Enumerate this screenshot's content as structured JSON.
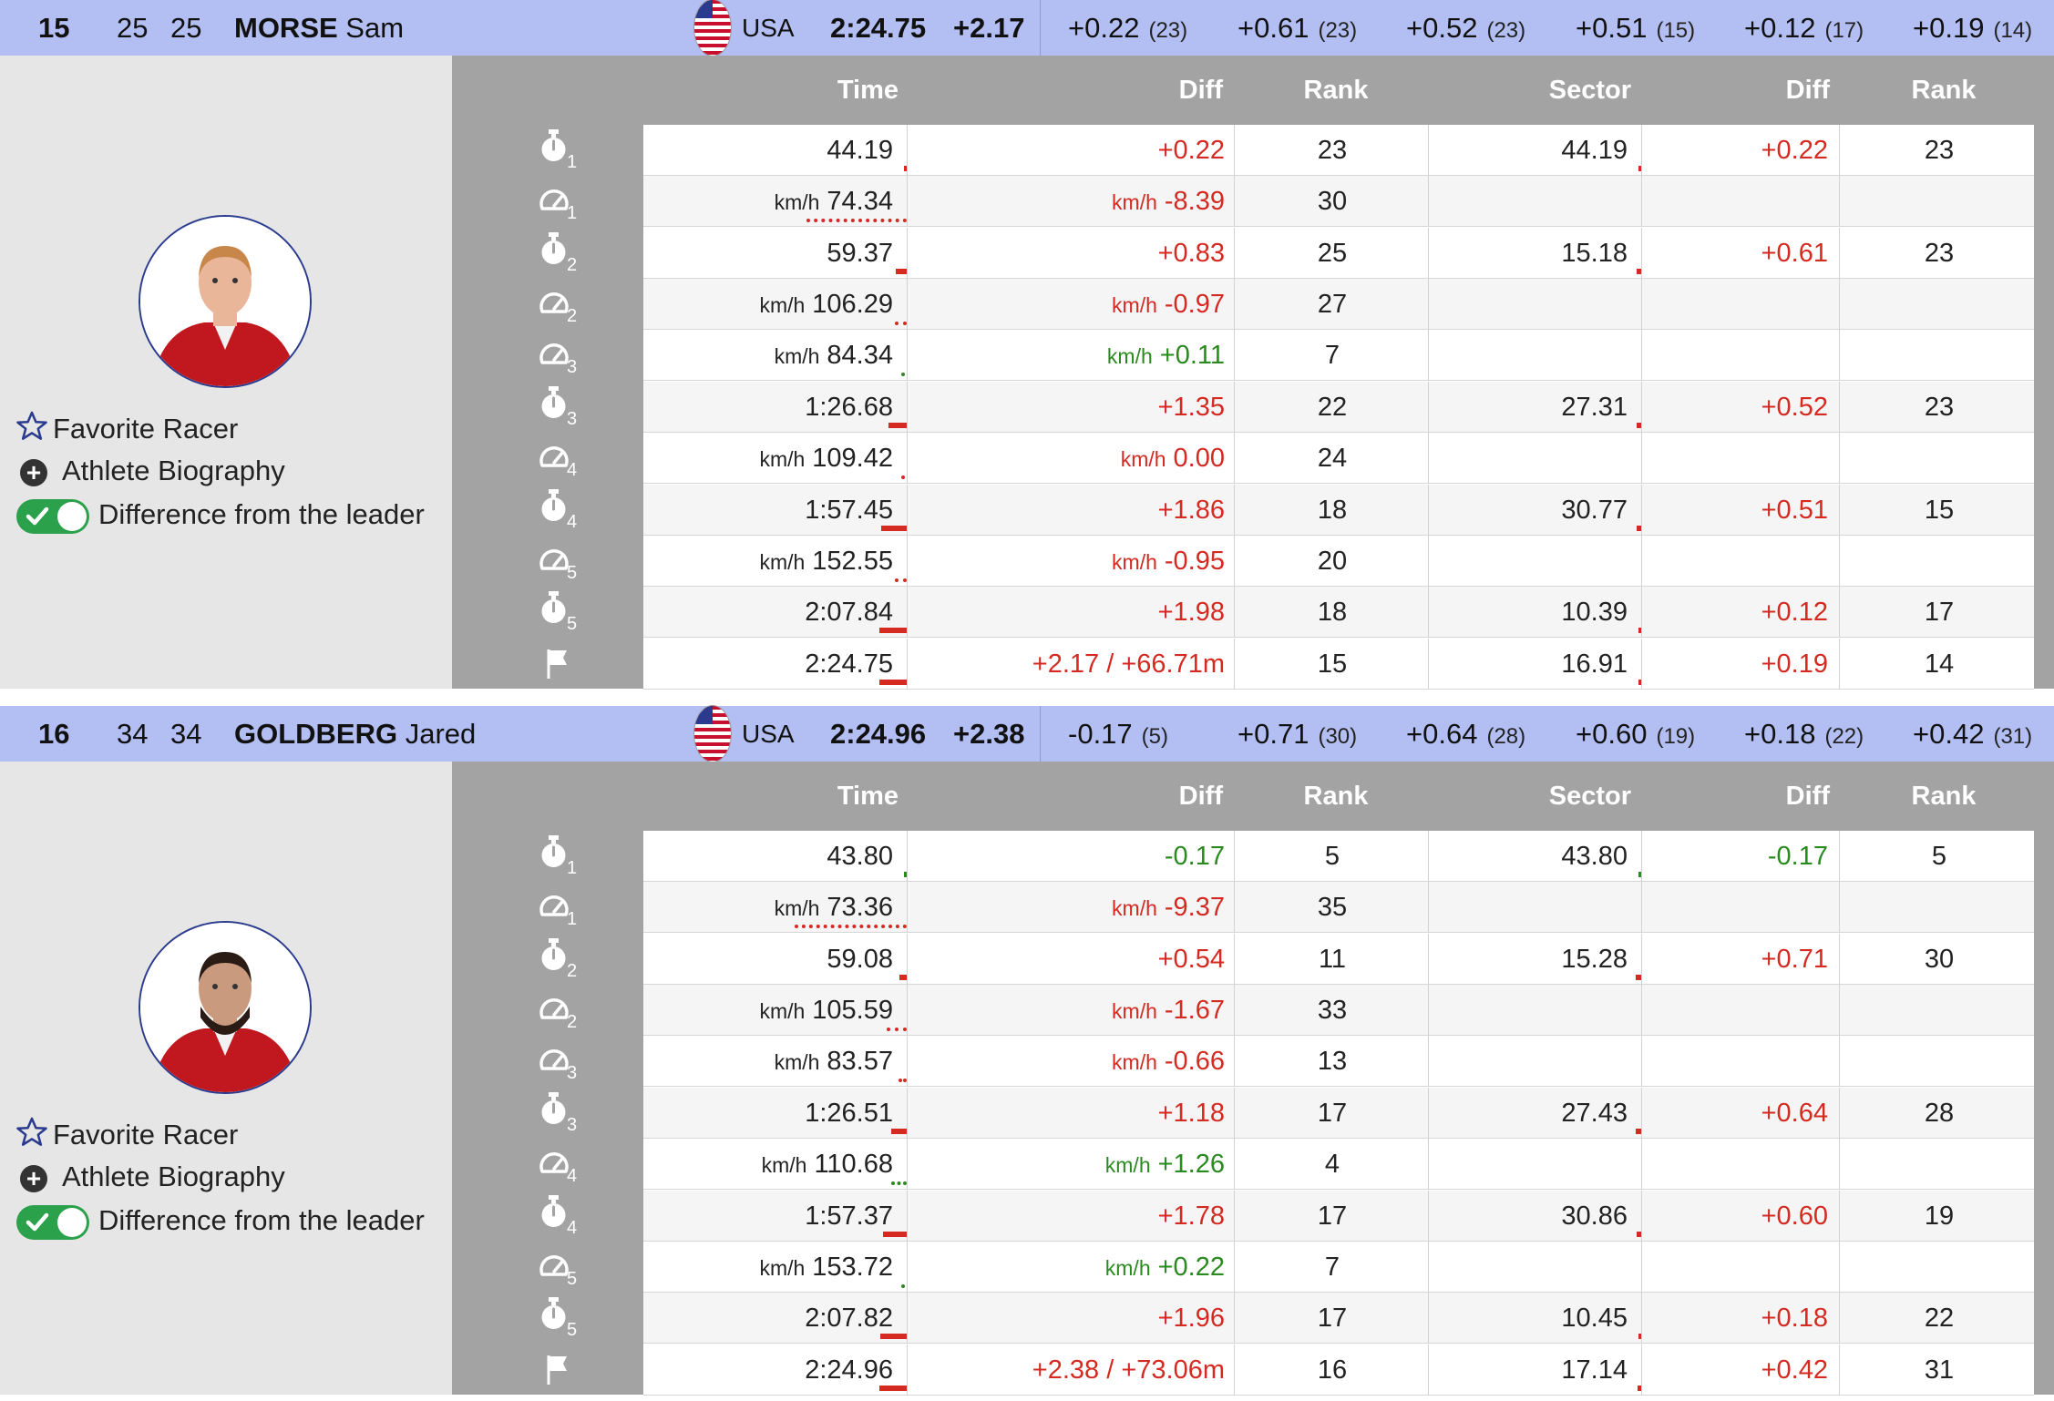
{
  "column_headers": {
    "time": "Time",
    "diff": "Diff",
    "rank": "Rank",
    "sector": "Sector",
    "sector_diff": "Diff",
    "sector_rank": "Rank"
  },
  "links": {
    "favorite": "Favorite Racer",
    "bio": "Athlete Biography",
    "toggle": "Difference from the leader"
  },
  "colors": {
    "header_bg": "#b3bef2",
    "left_bg": "#e6e6e6",
    "table_frame": "#a3a3a3",
    "negative": "#d42a22",
    "positive": "#2a8a1f",
    "toggle_on": "#2aa14a"
  },
  "icons": {
    "timing": "stopwatch-icon",
    "speed": "speedometer-icon",
    "finish": "finish-flag-icon",
    "favorite": "star-outline-icon",
    "bio": "plus-circle-icon",
    "toggle": "check-icon"
  },
  "racers": [
    {
      "rank": "15",
      "bib": "25",
      "start": "25",
      "last": "MORSE",
      "first": "Sam",
      "country": "USA",
      "total": "2:24.75",
      "gap": "+2.17",
      "splits": [
        {
          "v": "+0.22",
          "r": "(23)"
        },
        {
          "v": "+0.61",
          "r": "(23)"
        },
        {
          "v": "+0.52",
          "r": "(23)"
        },
        {
          "v": "+0.51",
          "r": "(15)"
        },
        {
          "v": "+0.12",
          "r": "(17)"
        },
        {
          "v": "+0.19",
          "r": "(14)"
        }
      ],
      "rows": [
        {
          "kind": "time",
          "sub": "1",
          "time": "44.19",
          "diff": "+0.22",
          "rank": "23",
          "sector": "44.19",
          "sdiff": "+0.22",
          "srank": "23",
          "ind_level": 0.11
        },
        {
          "kind": "speed",
          "sub": "1",
          "unit": "km/h",
          "time": "74.34",
          "dunit": "km/h",
          "diff": "-8.39",
          "rank": "30",
          "sector": "",
          "sdiff": "",
          "srank": "",
          "ind_level": 0.86
        },
        {
          "kind": "time",
          "sub": "2",
          "time": "59.37",
          "diff": "+0.83",
          "rank": "25",
          "sector": "15.18",
          "sdiff": "+0.61",
          "srank": "23",
          "ind_level": 0.41
        },
        {
          "kind": "speed",
          "sub": "2",
          "unit": "km/h",
          "time": "106.29",
          "dunit": "km/h",
          "diff": "-0.97",
          "rank": "27",
          "sector": "",
          "sdiff": "",
          "srank": "",
          "ind_level": 0.1
        },
        {
          "kind": "speed",
          "sub": "3",
          "unit": "km/h",
          "time": "84.34",
          "dunit": "km/h",
          "diff": "+0.11",
          "rank": "7",
          "sector": "",
          "sdiff": "",
          "srank": "",
          "ind_level": 0.02
        },
        {
          "kind": "time",
          "sub": "3",
          "time": "1:26.68",
          "diff": "+1.35",
          "rank": "22",
          "sector": "27.31",
          "sdiff": "+0.52",
          "srank": "23",
          "ind_level": 0.67
        },
        {
          "kind": "speed",
          "sub": "4",
          "unit": "km/h",
          "time": "109.42",
          "dunit": "km/h",
          "diff": "0.00",
          "rank": "24",
          "sector": "",
          "sdiff": "",
          "srank": "",
          "ind_level": 0
        },
        {
          "kind": "time",
          "sub": "4",
          "time": "1:57.45",
          "diff": "+1.86",
          "rank": "18",
          "sector": "30.77",
          "sdiff": "+0.51",
          "srank": "15",
          "ind_level": 0.93
        },
        {
          "kind": "speed",
          "sub": "5",
          "unit": "km/h",
          "time": "152.55",
          "dunit": "km/h",
          "diff": "-0.95",
          "rank": "20",
          "sector": "",
          "sdiff": "",
          "srank": "",
          "ind_level": 0.1
        },
        {
          "kind": "time",
          "sub": "5",
          "time": "2:07.84",
          "diff": "+1.98",
          "rank": "18",
          "sector": "10.39",
          "sdiff": "+0.12",
          "srank": "17",
          "ind_level": 0.99
        },
        {
          "kind": "finish",
          "sub": "",
          "time": "2:24.75",
          "diff": "+2.17 / +66.71m",
          "rank": "15",
          "sector": "16.91",
          "sdiff": "+0.19",
          "srank": "14",
          "ind_level": 1
        }
      ]
    },
    {
      "rank": "16",
      "bib": "34",
      "start": "34",
      "last": "GOLDBERG",
      "first": "Jared",
      "country": "USA",
      "total": "2:24.96",
      "gap": "+2.38",
      "splits": [
        {
          "v": "-0.17",
          "r": "(5)"
        },
        {
          "v": "+0.71",
          "r": "(30)"
        },
        {
          "v": "+0.64",
          "r": "(28)"
        },
        {
          "v": "+0.60",
          "r": "(19)"
        },
        {
          "v": "+0.18",
          "r": "(22)"
        },
        {
          "v": "+0.42",
          "r": "(31)"
        }
      ],
      "rows": [
        {
          "kind": "time",
          "sub": "1",
          "time": "43.80",
          "diff": "-0.17",
          "rank": "5",
          "sector": "43.80",
          "sdiff": "-0.17",
          "srank": "5",
          "ind_level": 0.08
        },
        {
          "kind": "speed",
          "sub": "1",
          "unit": "km/h",
          "time": "73.36",
          "dunit": "km/h",
          "diff": "-9.37",
          "rank": "35",
          "sector": "",
          "sdiff": "",
          "srank": "",
          "ind_level": 0.96
        },
        {
          "kind": "time",
          "sub": "2",
          "time": "59.08",
          "diff": "+0.54",
          "rank": "11",
          "sector": "15.28",
          "sdiff": "+0.71",
          "srank": "30",
          "ind_level": 0.26
        },
        {
          "kind": "speed",
          "sub": "2",
          "unit": "km/h",
          "time": "105.59",
          "dunit": "km/h",
          "diff": "-1.67",
          "rank": "33",
          "sector": "",
          "sdiff": "",
          "srank": "",
          "ind_level": 0.17
        },
        {
          "kind": "speed",
          "sub": "3",
          "unit": "km/h",
          "time": "83.57",
          "dunit": "km/h",
          "diff": "-0.66",
          "rank": "13",
          "sector": "",
          "sdiff": "",
          "srank": "",
          "ind_level": 0.07
        },
        {
          "kind": "time",
          "sub": "3",
          "time": "1:26.51",
          "diff": "+1.18",
          "rank": "17",
          "sector": "27.43",
          "sdiff": "+0.64",
          "srank": "28",
          "ind_level": 0.58
        },
        {
          "kind": "speed",
          "sub": "4",
          "unit": "km/h",
          "time": "110.68",
          "dunit": "km/h",
          "diff": "+1.26",
          "rank": "4",
          "sector": "",
          "sdiff": "",
          "srank": "",
          "ind_level": 0.13
        },
        {
          "kind": "time",
          "sub": "4",
          "time": "1:57.37",
          "diff": "+1.78",
          "rank": "17",
          "sector": "30.86",
          "sdiff": "+0.60",
          "srank": "19",
          "ind_level": 0.87
        },
        {
          "kind": "speed",
          "sub": "5",
          "unit": "km/h",
          "time": "153.72",
          "dunit": "km/h",
          "diff": "+0.22",
          "rank": "7",
          "sector": "",
          "sdiff": "",
          "srank": "",
          "ind_level": 0.02
        },
        {
          "kind": "time",
          "sub": "5",
          "time": "2:07.82",
          "diff": "+1.96",
          "rank": "17",
          "sector": "10.45",
          "sdiff": "+0.18",
          "srank": "22",
          "ind_level": 0.96
        },
        {
          "kind": "finish",
          "sub": "",
          "time": "2:24.96",
          "diff": "+2.38 / +73.06m",
          "rank": "16",
          "sector": "17.14",
          "sdiff": "+0.42",
          "srank": "31",
          "ind_level": 1
        }
      ]
    }
  ]
}
